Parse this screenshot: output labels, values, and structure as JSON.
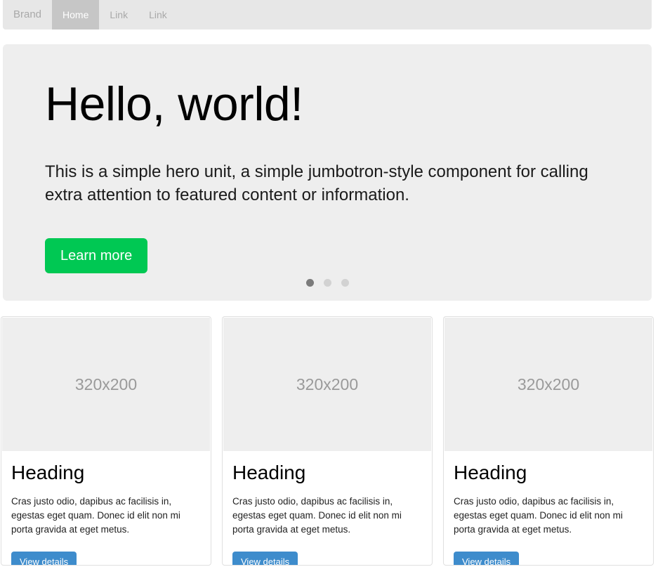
{
  "navbar": {
    "brand": "Brand",
    "items": [
      {
        "label": "Home",
        "active": true
      },
      {
        "label": "Link",
        "active": false
      },
      {
        "label": "Link",
        "active": false
      }
    ]
  },
  "jumbotron": {
    "title": "Hello, world!",
    "text": "This is a simple hero unit, a simple jumbotron-style component for calling extra attention to featured content or information.",
    "button_label": "Learn more",
    "button_color": "#00c853",
    "background_color": "#eeeeee",
    "carousel": {
      "dots": [
        {
          "active": true
        },
        {
          "active": false
        },
        {
          "active": false
        }
      ]
    }
  },
  "cards": [
    {
      "image_label": "320x200",
      "heading": "Heading",
      "text": "Cras justo odio, dapibus ac facilisis in, egestas eget quam. Donec id elit non mi porta gravida at eget metus.",
      "button_label": "View details",
      "button_color": "#3e8ccc"
    },
    {
      "image_label": "320x200",
      "heading": "Heading",
      "text": "Cras justo odio, dapibus ac facilisis in, egestas eget quam. Donec id elit non mi porta gravida at eget metus.",
      "button_label": "View details",
      "button_color": "#3e8ccc"
    },
    {
      "image_label": "320x200",
      "heading": "Heading",
      "text": "Cras justo odio, dapibus ac facilisis in, egestas eget quam. Donec id elit non mi porta gravida at eget metus.",
      "button_label": "View details",
      "button_color": "#3e8ccc"
    }
  ]
}
